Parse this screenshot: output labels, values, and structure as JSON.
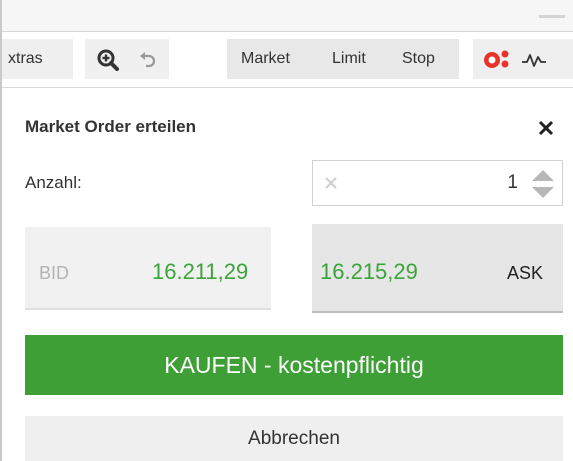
{
  "toolbar": {
    "extras_label": "xtras",
    "market_label": "Market",
    "limit_label": "Limit",
    "stop_label": "Stop"
  },
  "order_panel": {
    "title": "Market Order erteilen",
    "quantity_label": "Anzahl:",
    "quantity_value": "1",
    "bid_label": "BID",
    "bid_price": "16.211,29",
    "ask_price": "16.215,29",
    "ask_label": "ASK",
    "buy_button_label": "KAUFEN - kostenpflichtig",
    "cancel_button_label": "Abbrechen"
  },
  "colors": {
    "price_green": "#3aa33a",
    "buy_button_green": "#3d9f36",
    "alert_icon_red": "#e8332b"
  },
  "icons": [
    "zoom-in-icon",
    "undo-icon",
    "indicator-icon",
    "chart-line-icon",
    "close-icon",
    "clear-icon",
    "stepper-icon"
  ]
}
